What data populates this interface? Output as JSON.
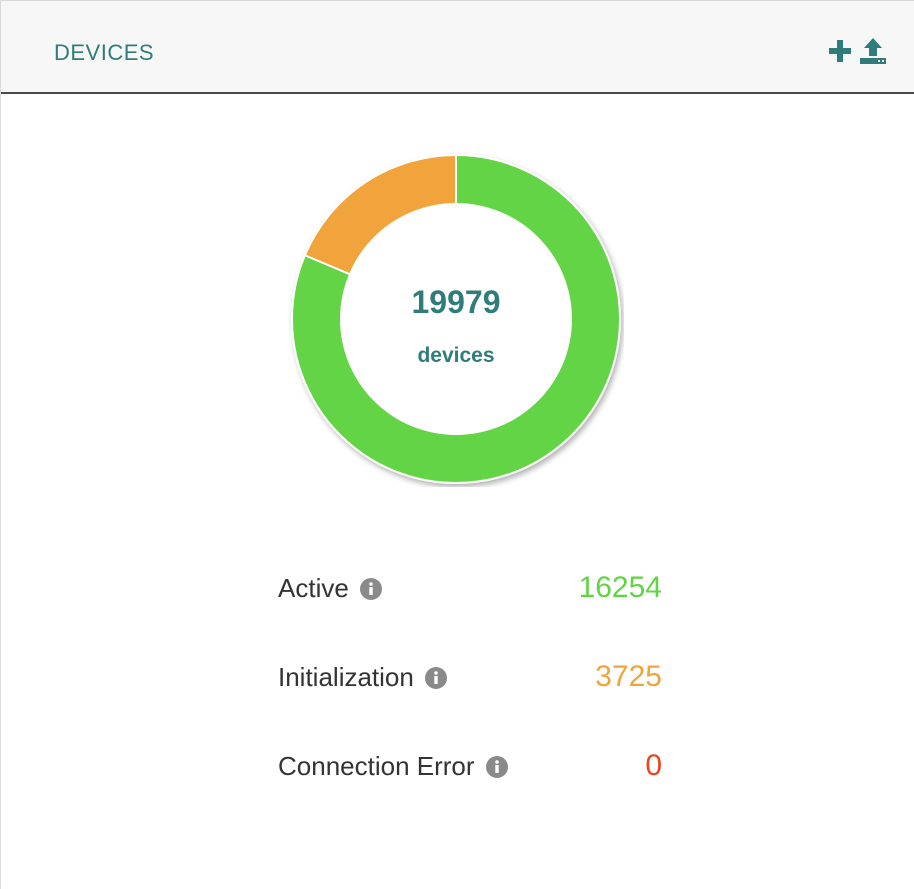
{
  "header": {
    "title": "DEVICES",
    "actions": [
      {
        "icon": "plus-icon"
      },
      {
        "icon": "upload-icon"
      }
    ]
  },
  "summary": {
    "total": "19979",
    "unit_label": "devices"
  },
  "colors": {
    "accent": "#2f7c7a",
    "active": "#62d444",
    "initialization": "#f0a43a",
    "connection_error": "#e8461e"
  },
  "statuses": [
    {
      "label": "Active",
      "value": "16254",
      "icon": "info-icon"
    },
    {
      "label": "Initialization",
      "value": "3725",
      "icon": "info-icon"
    },
    {
      "label": "Connection Error",
      "value": "0",
      "icon": "info-icon"
    }
  ],
  "chart_data": {
    "type": "pie",
    "categories": [
      "Active",
      "Initialization",
      "Connection Error"
    ],
    "values": [
      16254,
      3725,
      0
    ]
  }
}
